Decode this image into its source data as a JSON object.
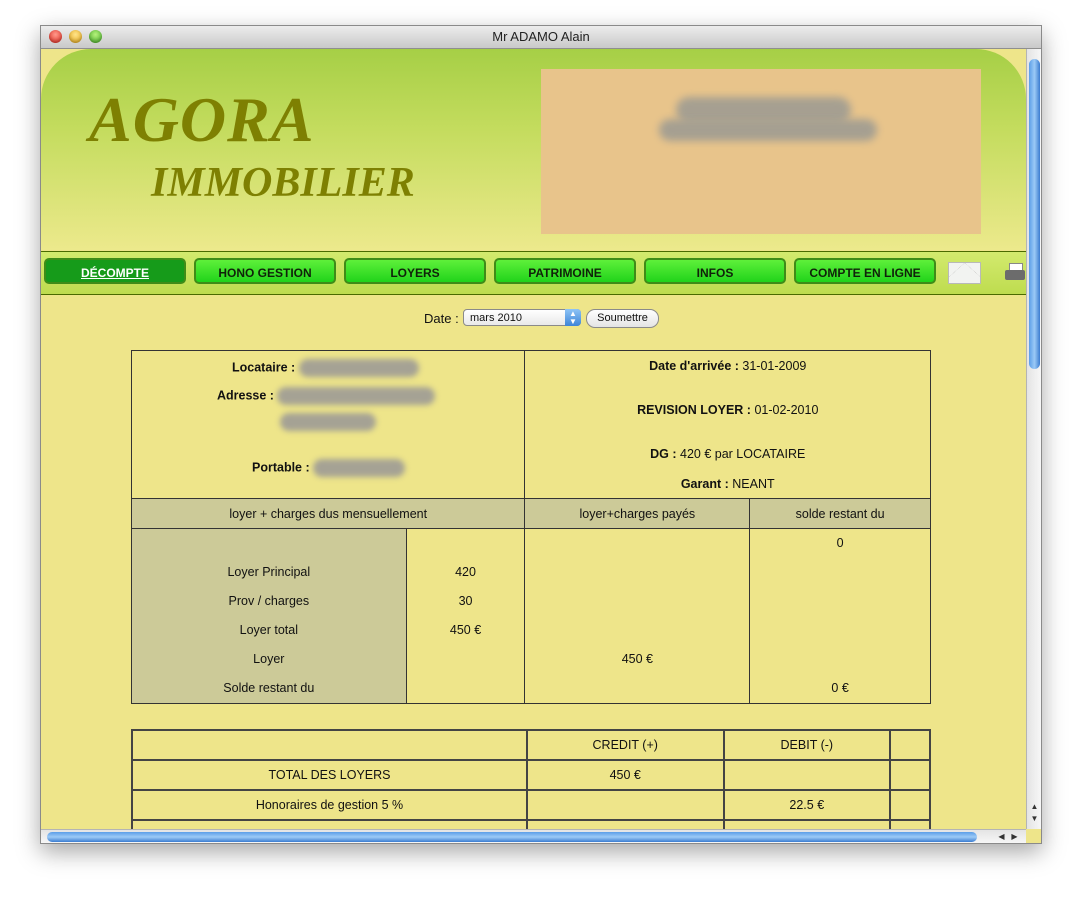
{
  "window": {
    "title": "Mr ADAMO Alain"
  },
  "banner": {
    "logo_line1": "AGORA",
    "logo_line2": "IMMOBILIER"
  },
  "nav": {
    "items": [
      {
        "label": "DÉCOMPTE",
        "active": true
      },
      {
        "label": "HONO GESTION",
        "active": false
      },
      {
        "label": "LOYERS",
        "active": false
      },
      {
        "label": "PATRIMOINE",
        "active": false
      },
      {
        "label": "INFOS",
        "active": false
      },
      {
        "label": "COMPTE EN LIGNE",
        "active": false
      }
    ],
    "icons": [
      "envelope-icon",
      "printer-icon"
    ]
  },
  "date_filter": {
    "label": "Date :",
    "selected": "mars 2010",
    "submit_label": "Soumettre"
  },
  "tenant": {
    "locataire_label": "Locataire :",
    "adresse_label": "Adresse :",
    "portable_label": "Portable :",
    "date_arrivee_label": "Date d'arrivée :",
    "date_arrivee_value": "31-01-2009",
    "revision_label": "REVISION LOYER :",
    "revision_value": "01-02-2010",
    "dg_label": "DG :",
    "dg_value": "420 € par LOCATAIRE",
    "garant_label": "Garant :",
    "garant_value": "NEANT"
  },
  "headers": {
    "dus": "loyer + charges dus mensuellement",
    "payes": "loyer+charges payés",
    "solde": "solde restant du"
  },
  "rows": {
    "solde_initial": "0",
    "loyer_principal_label": "Loyer Principal",
    "loyer_principal_value": "420",
    "prov_charges_label": "Prov / charges",
    "prov_charges_value": "30",
    "loyer_total_label": "Loyer total",
    "loyer_total_value": "450 €",
    "loyer_label": "Loyer",
    "loyer_paye": "450 €",
    "solde_label": "Solde restant du",
    "solde_value": "0 €"
  },
  "ledger": {
    "credit_header": "CREDIT (+)",
    "debit_header": "DEBIT (-)",
    "total_loyers_label": "TOTAL DES LOYERS",
    "total_loyers_credit": "450 €",
    "honoraires_label": "Honoraires de gestion 5 %",
    "honoraires_debit": "22.5 €"
  },
  "colors": {
    "page_bg": "#eee58a",
    "logo": "#7e8002",
    "nav_button": "#2ed61f",
    "nav_active": "#169b1a",
    "table_gray": "#ccca98",
    "agency_box": "#e8c48b"
  }
}
